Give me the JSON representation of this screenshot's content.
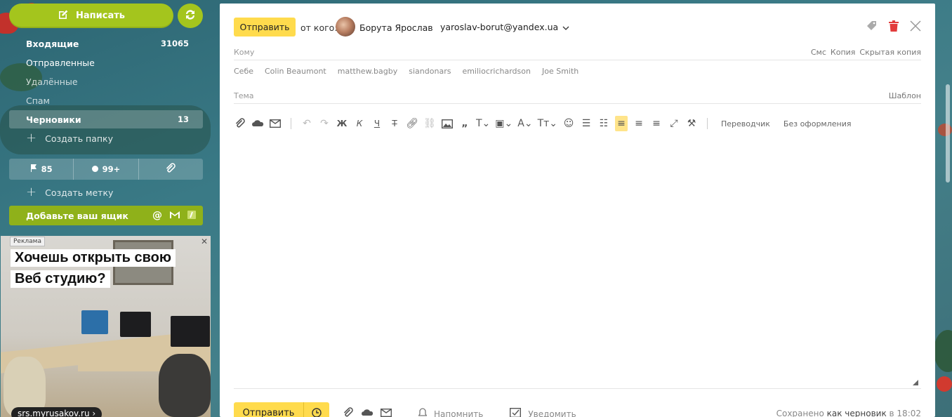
{
  "sidebar": {
    "compose_label": "Написать",
    "folders": [
      {
        "label": "Входящие",
        "count": "31065"
      },
      {
        "label": "Отправленные",
        "count": ""
      },
      {
        "label": "Удалённые",
        "count": ""
      },
      {
        "label": "Спам",
        "count": ""
      },
      {
        "label": "Черновики",
        "count": "13"
      }
    ],
    "create_folder": "Создать папку",
    "stats": {
      "flagged": "85",
      "unread": "99+"
    },
    "create_label": "Создать метку",
    "add_mailbox": "Добавьте ваш ящик"
  },
  "ad": {
    "tag": "Реклама",
    "line1": "Хочешь открыть свою",
    "line2": "Веб студию?",
    "url": "srs.myrusakov.ru ›"
  },
  "compose": {
    "send_label": "Отправить",
    "from_label": "от кого:",
    "from_name": "Борута Ярослав",
    "from_email": "yaroslav-borut@yandex.ua",
    "to_label": "Кому",
    "to_options": [
      "Смс",
      "Копия",
      "Скрытая копия"
    ],
    "contacts": [
      "Себе",
      "Colin Beaumont",
      "matthew.bagby",
      "siandonars",
      "emiliocrichardson",
      "Joe Smith"
    ],
    "subject_label": "Тема",
    "template_label": "Шаблон",
    "toolbar": {
      "translator": "Переводчик",
      "plain": "Без оформления",
      "bold": "Ж",
      "italic": "К",
      "underline": "Ч",
      "strike": "Т"
    },
    "bottom": {
      "send_label": "Отправить",
      "remind": "Напомнить",
      "notify": "Уведомить",
      "saved_prefix": "Сохранено",
      "saved_link": "как черновик",
      "saved_suffix": "в 18:02"
    }
  },
  "colors": {
    "accent_green": "#a4c51d",
    "send_yellow": "#ffdb4d",
    "delete_red": "#e23b3b"
  }
}
